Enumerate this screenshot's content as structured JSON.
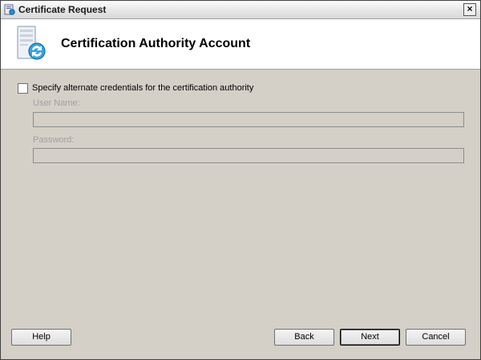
{
  "window": {
    "title": "Certificate Request",
    "close_glyph": "×"
  },
  "header": {
    "title": "Certification Authority Account",
    "icon": "certificate-server-icon"
  },
  "form": {
    "checkbox_label": "Specify alternate credentials for the certification authority",
    "checkbox_checked": false,
    "username_label": "User Name:",
    "username_value": "",
    "password_label": "Password:",
    "password_value": ""
  },
  "buttons": {
    "help": "Help",
    "back": "Back",
    "next": "Next",
    "cancel": "Cancel"
  },
  "colors": {
    "dialog_background": "#d4d0c8",
    "header_background": "#ffffff",
    "disabled_text": "#a0a0a0"
  }
}
